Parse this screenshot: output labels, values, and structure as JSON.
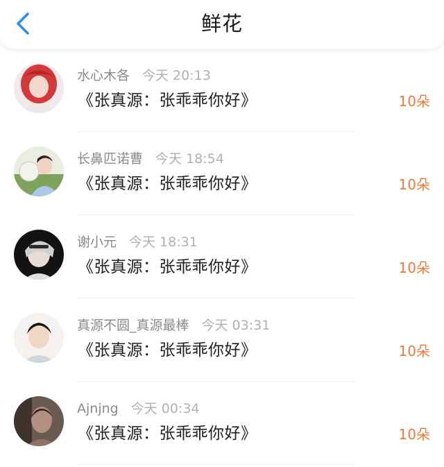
{
  "header": {
    "title": "鲜花",
    "back_icon": "chevron-left-icon",
    "accent_color": "#2a8bf2"
  },
  "flowers": [
    {
      "avatar_icon": "user-avatar",
      "username": "水心木各",
      "time": "今天 20:13",
      "message": "《张真源：张乖乖你好》",
      "count": "10朵"
    },
    {
      "avatar_icon": "user-avatar",
      "username": "长鼻匹诺曹",
      "time": "今天 18:54",
      "message": "《张真源：张乖乖你好》",
      "count": "10朵"
    },
    {
      "avatar_icon": "user-avatar",
      "username": "谢小元",
      "time": "今天 18:31",
      "message": "《张真源：张乖乖你好》",
      "count": "10朵"
    },
    {
      "avatar_icon": "user-avatar",
      "username": "真源不圆_真源最棒",
      "time": "今天 03:31",
      "message": "《张真源：张乖乖你好》",
      "count": "10朵"
    },
    {
      "avatar_icon": "user-avatar",
      "username": "Ajnjng",
      "time": "今天 00:34",
      "message": "《张真源：张乖乖你好》",
      "count": "10朵"
    }
  ],
  "colors": {
    "count": "#ee7a36",
    "username": "#8a8a8a",
    "time": "#b0b0b0",
    "message": "#1f1f1f"
  }
}
